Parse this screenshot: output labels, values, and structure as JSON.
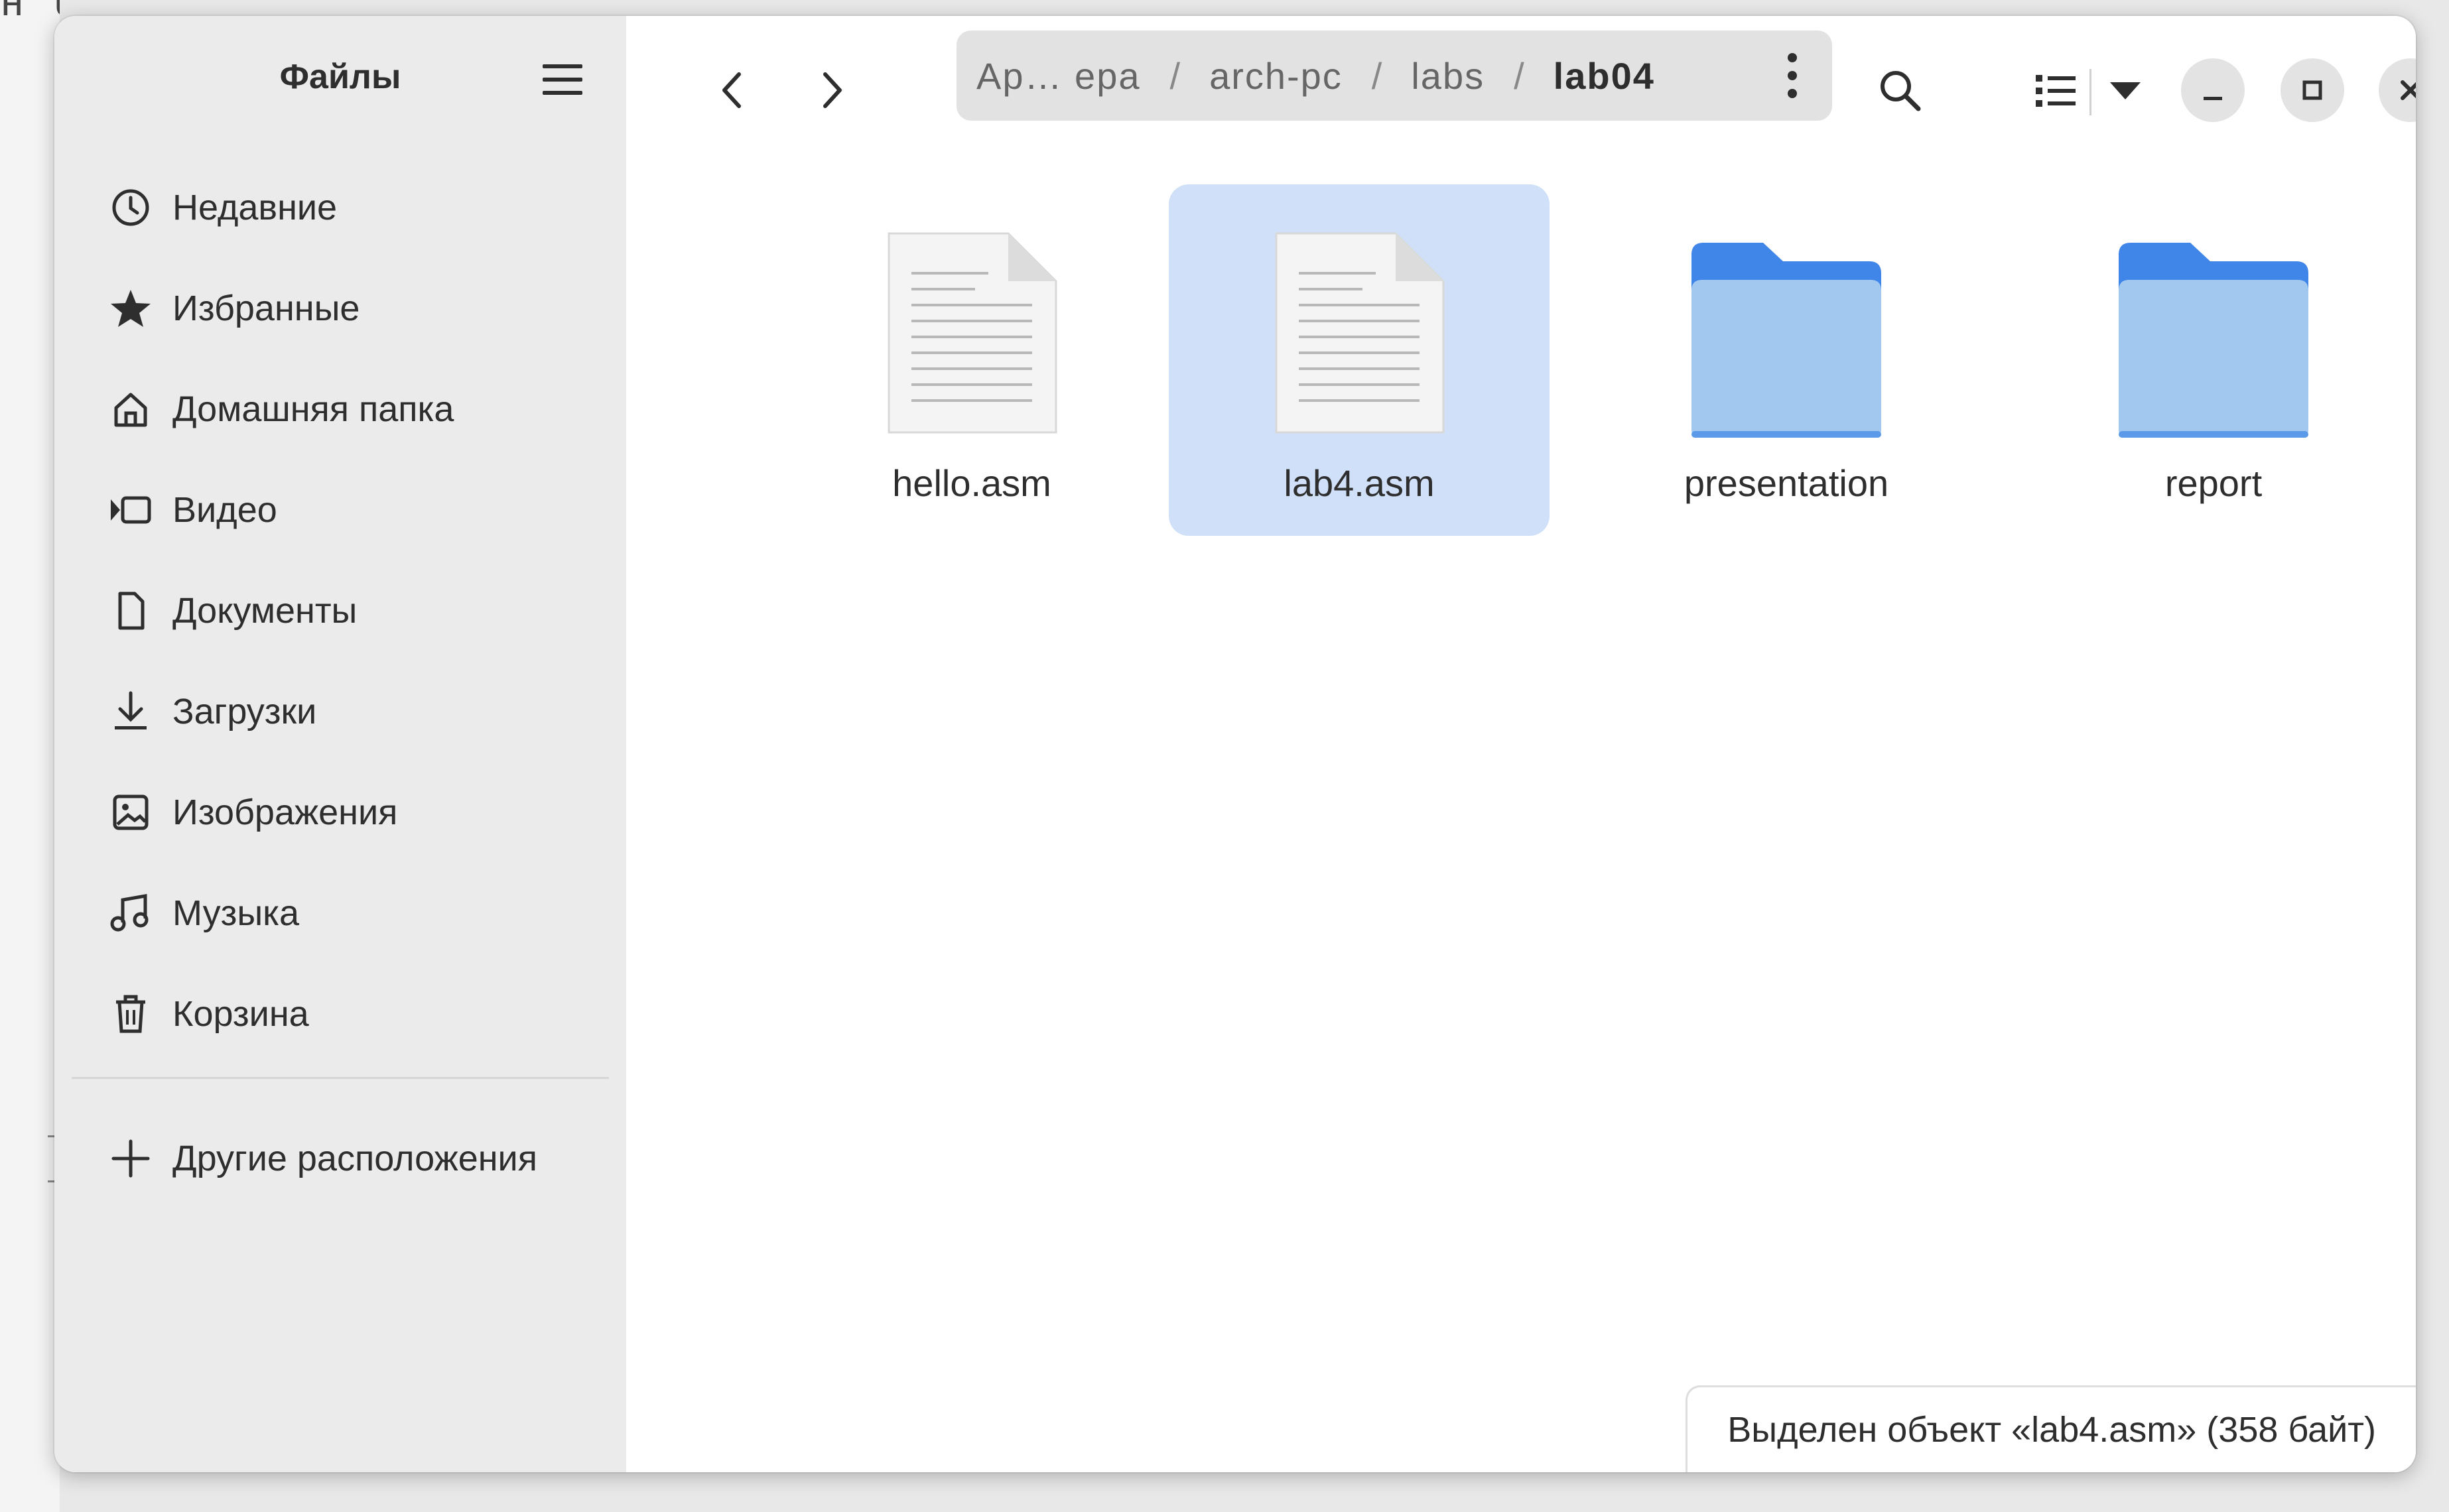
{
  "window": {
    "sidebar_title": "Файлы"
  },
  "sidebar": {
    "items": [
      {
        "label": "Недавние",
        "icon": "clock-icon"
      },
      {
        "label": "Избранные",
        "icon": "star-icon"
      },
      {
        "label": "Домашняя папка",
        "icon": "home-icon"
      },
      {
        "label": "Видео",
        "icon": "video-icon"
      },
      {
        "label": "Документы",
        "icon": "document-icon"
      },
      {
        "label": "Загрузки",
        "icon": "download-icon"
      },
      {
        "label": "Изображения",
        "icon": "image-icon"
      },
      {
        "label": "Музыка",
        "icon": "music-icon"
      },
      {
        "label": "Корзина",
        "icon": "trash-icon"
      }
    ],
    "other_locations": {
      "label": "Другие расположения",
      "icon": "plus-icon"
    }
  },
  "pathbar": {
    "crumbs": [
      "Ар… ера",
      "arch-pc",
      "labs",
      "lab04"
    ],
    "separator": "/"
  },
  "files": [
    {
      "name": "hello.asm",
      "kind": "text-file",
      "selected": false
    },
    {
      "name": "lab4.asm",
      "kind": "text-file",
      "selected": true
    },
    {
      "name": "presentation",
      "kind": "folder",
      "selected": false
    },
    {
      "name": "report",
      "kind": "folder",
      "selected": false
    }
  ],
  "status": {
    "text": "Выделен объект «lab4.asm»  (358 байт)"
  },
  "colors": {
    "accent_selection": "#cfe0f8",
    "folder_back": "#3f86e8",
    "folder_front": "#a3c8f0"
  }
}
